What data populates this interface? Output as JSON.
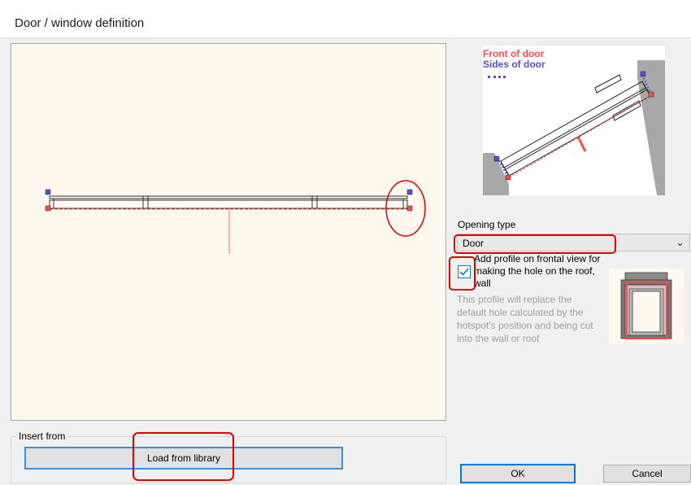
{
  "window": {
    "title": "Door / window definition"
  },
  "diagram": {
    "front_label": "Front of door",
    "sides_label": "Sides of door"
  },
  "opening": {
    "label": "Opening type",
    "selected": "Door",
    "options_visible": [
      "Door"
    ]
  },
  "profile": {
    "checked": true,
    "label": "Add profile on frontal view for making the hole on the roof, wall",
    "description": "This profile will replace the default hole calculated by the hotspot's position and being cut into the wall or roof"
  },
  "insert": {
    "group_label": "Insert from",
    "load_button": "Load from library"
  },
  "buttons": {
    "ok": "OK",
    "cancel": "Cancel"
  },
  "colors": {
    "canvas_bg": "#fef8ef",
    "front": "#ff4a4a",
    "sides": "#5050d8",
    "annotation": "#e00000",
    "accent": "#0078d7"
  }
}
